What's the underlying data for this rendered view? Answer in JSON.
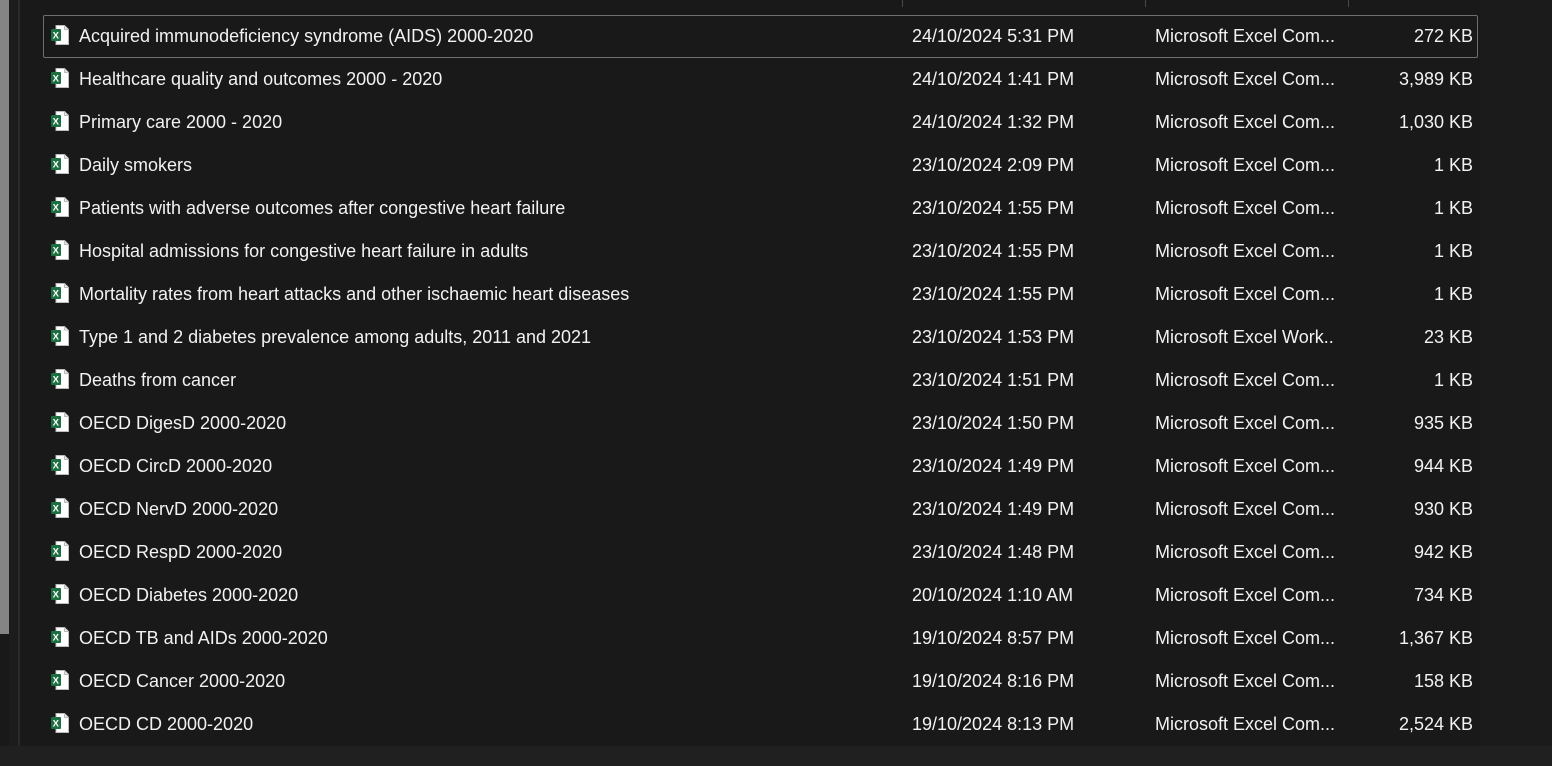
{
  "colors": {
    "background": "#191919",
    "text": "#f2f2f2",
    "excel_icon": "#1d6f42",
    "selected_border": "#6e6e6e"
  },
  "files": [
    {
      "name": "Acquired immunodeficiency syndrome (AIDS) 2000-2020",
      "date": "24/10/2024 5:31 PM",
      "type": "Microsoft Excel Com...",
      "size": "272 KB",
      "icon": "excel-csv-icon",
      "selected": true
    },
    {
      "name": "Healthcare quality and outcomes 2000 - 2020",
      "date": "24/10/2024 1:41 PM",
      "type": "Microsoft Excel Com...",
      "size": "3,989 KB",
      "icon": "excel-csv-icon"
    },
    {
      "name": "Primary care 2000 - 2020",
      "date": "24/10/2024 1:32 PM",
      "type": "Microsoft Excel Com...",
      "size": "1,030 KB",
      "icon": "excel-csv-icon"
    },
    {
      "name": "Daily smokers",
      "date": "23/10/2024 2:09 PM",
      "type": "Microsoft Excel Com...",
      "size": "1 KB",
      "icon": "excel-csv-icon"
    },
    {
      "name": "Patients with adverse outcomes after congestive heart failure",
      "date": "23/10/2024 1:55 PM",
      "type": "Microsoft Excel Com...",
      "size": "1 KB",
      "icon": "excel-csv-icon"
    },
    {
      "name": "Hospital admissions for congestive heart failure in adults",
      "date": "23/10/2024 1:55 PM",
      "type": "Microsoft Excel Com...",
      "size": "1 KB",
      "icon": "excel-csv-icon"
    },
    {
      "name": "Mortality rates from heart attacks and other ischaemic heart diseases",
      "date": "23/10/2024 1:55 PM",
      "type": "Microsoft Excel Com...",
      "size": "1 KB",
      "icon": "excel-csv-icon"
    },
    {
      "name": "Type 1 and 2 diabetes prevalence among adults, 2011 and 2021",
      "date": "23/10/2024 1:53 PM",
      "type": "Microsoft Excel Work...",
      "size": "23 KB",
      "icon": "excel-workbook-icon"
    },
    {
      "name": "Deaths from cancer",
      "date": "23/10/2024 1:51 PM",
      "type": "Microsoft Excel Com...",
      "size": "1 KB",
      "icon": "excel-csv-icon"
    },
    {
      "name": "OECD DigesD 2000-2020",
      "date": "23/10/2024 1:50 PM",
      "type": "Microsoft Excel Com...",
      "size": "935 KB",
      "icon": "excel-csv-icon"
    },
    {
      "name": "OECD CircD 2000-2020",
      "date": "23/10/2024 1:49 PM",
      "type": "Microsoft Excel Com...",
      "size": "944 KB",
      "icon": "excel-csv-icon"
    },
    {
      "name": "OECD NervD 2000-2020",
      "date": "23/10/2024 1:49 PM",
      "type": "Microsoft Excel Com...",
      "size": "930 KB",
      "icon": "excel-csv-icon"
    },
    {
      "name": "OECD RespD 2000-2020",
      "date": "23/10/2024 1:48 PM",
      "type": "Microsoft Excel Com...",
      "size": "942 KB",
      "icon": "excel-csv-icon"
    },
    {
      "name": "OECD Diabetes 2000-2020",
      "date": "20/10/2024 1:10 AM",
      "type": "Microsoft Excel Com...",
      "size": "734 KB",
      "icon": "excel-csv-icon"
    },
    {
      "name": "OECD TB and AIDs 2000-2020",
      "date": "19/10/2024 8:57 PM",
      "type": "Microsoft Excel Com...",
      "size": "1,367 KB",
      "icon": "excel-csv-icon"
    },
    {
      "name": "OECD Cancer 2000-2020",
      "date": "19/10/2024 8:16 PM",
      "type": "Microsoft Excel Com...",
      "size": "158 KB",
      "icon": "excel-csv-icon"
    },
    {
      "name": "OECD CD 2000-2020",
      "date": "19/10/2024 8:13 PM",
      "type": "Microsoft Excel Com...",
      "size": "2,524 KB",
      "icon": "excel-csv-icon"
    }
  ]
}
